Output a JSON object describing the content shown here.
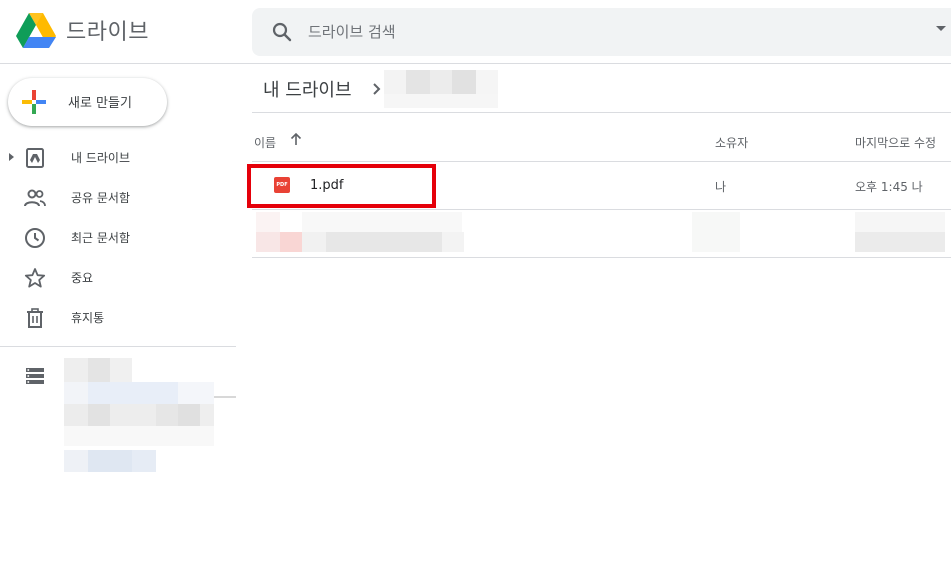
{
  "header": {
    "app_name": "드라이브",
    "search_placeholder": "드라이브 검색"
  },
  "sidebar": {
    "new_label": "새로 만들기",
    "items": [
      {
        "label": "내 드라이브",
        "icon": "drive-folder-icon"
      },
      {
        "label": "공유 문서함",
        "icon": "people-icon"
      },
      {
        "label": "최근 문서함",
        "icon": "clock-icon"
      },
      {
        "label": "중요",
        "icon": "star-icon"
      },
      {
        "label": "휴지통",
        "icon": "trash-icon"
      }
    ]
  },
  "breadcrumb": {
    "root": "내 드라이브"
  },
  "table": {
    "columns": {
      "name": "이름",
      "owner": "소유자",
      "modified": "마지막으로 수정"
    },
    "rows": [
      {
        "icon": "pdf-icon",
        "icon_text": "PDF",
        "name": "1.pdf",
        "owner": "나",
        "modified": "오후 1:45 나"
      }
    ]
  },
  "colors": {
    "highlight": "#e5000a",
    "pdf_red": "#e94235"
  }
}
